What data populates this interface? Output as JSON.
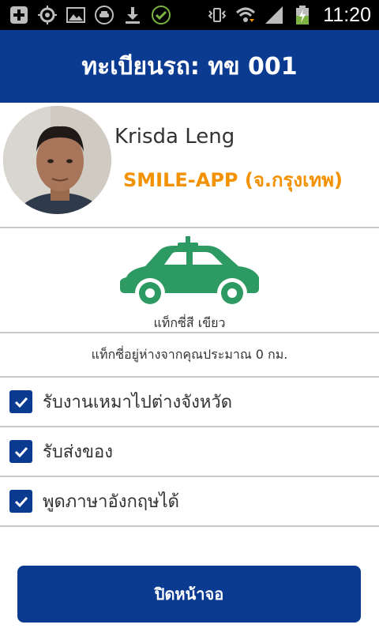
{
  "status_bar": {
    "time": "11:20",
    "left_icons": [
      "add-box-icon",
      "gps-target-icon",
      "image-icon",
      "taxi-app-icon",
      "download-icon",
      "check-circle-icon"
    ],
    "right_icons": [
      "vibrate-icon",
      "wifi-icon",
      "signal-icon",
      "battery-charging-icon"
    ]
  },
  "header": {
    "title": "ทะเบียนรถ: ทข 001"
  },
  "profile": {
    "name": "Krisda Leng",
    "company": "SMILE-APP (จ.กรุงเทพ)"
  },
  "car": {
    "color_label": "แท็กซี่สี เขียว",
    "icon": "taxi-car-icon",
    "icon_color": "#2e9a63"
  },
  "distance_text": "แท็กซี่อยู่ห่างจากคุณประมาณ 0 กม.",
  "checklist": [
    {
      "label": "รับงานเหมาไปต่างจังหวัด",
      "checked": true
    },
    {
      "label": "รับส่งของ",
      "checked": true
    },
    {
      "label": "พูดภาษาอังกฤษได้",
      "checked": true
    }
  ],
  "close_button": {
    "label": "ปิดหน้าจอ"
  },
  "colors": {
    "primary": "#0b3b91",
    "accent": "#f39200",
    "car": "#2e9a63"
  }
}
